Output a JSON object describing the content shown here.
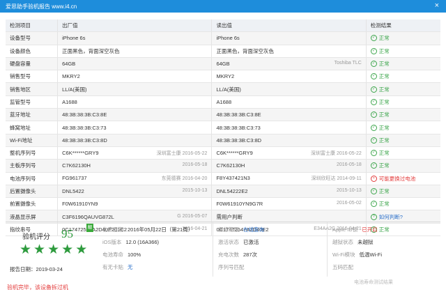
{
  "window": {
    "title": "爱思助手验机报告 www.i4.cn",
    "close_label": "×"
  },
  "table": {
    "headers": [
      "检测项目",
      "出厂值",
      "读出值",
      "检测结果"
    ],
    "rows": [
      {
        "label": "设备型号",
        "factory": "iPhone 6s",
        "factory_note": "",
        "read": "iPhone 6s",
        "read_note": "",
        "result": "正常",
        "status": "ok"
      },
      {
        "label": "设备颜色",
        "factory": "正面黑色，背面深空灰色",
        "factory_note": "",
        "read": "正面黑色，背面深空灰色",
        "read_note": "",
        "result": "正常",
        "status": "ok"
      },
      {
        "label": "硬盘容量",
        "factory": "64GB",
        "factory_note": "",
        "read": "64GB",
        "read_note": "Toshiba TLC",
        "result": "正常",
        "status": "ok"
      },
      {
        "label": "销售型号",
        "factory": "MKRY2",
        "factory_note": "",
        "read": "MKRY2",
        "read_note": "",
        "result": "正常",
        "status": "ok"
      },
      {
        "label": "销售地区",
        "factory": "LL/A(美国)",
        "factory_note": "",
        "read": "LL/A(美国)",
        "read_note": "",
        "result": "正常",
        "status": "ok"
      },
      {
        "label": "监管型号",
        "factory": "A1688",
        "factory_note": "",
        "read": "A1688",
        "read_note": "",
        "result": "正常",
        "status": "ok"
      },
      {
        "label": "蓝牙地址",
        "factory": "48:3B:38:3B:C3:8E",
        "factory_note": "",
        "read": "48:3B:38:3B:C3:8E",
        "read_note": "",
        "result": "正常",
        "status": "ok"
      },
      {
        "label": "蜂窝地址",
        "factory": "48:3B:38:3B:C3:73",
        "factory_note": "",
        "read": "48:3B:38:3B:C3:73",
        "read_note": "",
        "result": "正常",
        "status": "ok"
      },
      {
        "label": "Wi-Fi地址",
        "factory": "48:3B:38:3B:C3:8D",
        "factory_note": "",
        "read": "48:3B:38:3B:C3:8D",
        "read_note": "",
        "result": "正常",
        "status": "ok"
      },
      {
        "label": "整机序列号",
        "factory": "C6K******GRY9",
        "factory_note": "深圳富士康 2016-05-22",
        "read": "C6K******GRY9",
        "read_note": "深圳富士康 2016-05-22",
        "result": "正常",
        "status": "ok"
      },
      {
        "label": "主板序列号",
        "factory": "C7K62130H",
        "factory_note": "2016-05-18",
        "read": "C7K62130H",
        "read_note": "2016-05-18",
        "result": "正常",
        "status": "ok"
      },
      {
        "label": "电池序列号",
        "factory": "FG961737",
        "factory_note": "东莞德赛 2016-04-20",
        "read": "F8Y437421N3",
        "read_note": "深圳欣旺达 2014-09-11",
        "result": "可能更换过电池",
        "status": "bad"
      },
      {
        "label": "后置摄像头",
        "factory": "DNL5422",
        "factory_note": "2015-10-13",
        "read": "DNL54222E2",
        "read_note": "2015-10-13",
        "result": "正常",
        "status": "ok"
      },
      {
        "label": "前置摄像头",
        "factory": "F0W61910YN9",
        "factory_note": "",
        "read": "F0W61910YN9G7R",
        "read_note": "2016-05-02",
        "result": "正常",
        "status": "ok"
      },
      {
        "label": "液晶显示屏",
        "factory": "C3F6196QAUVG872L",
        "factory_note": "G 2016-05-07",
        "read": "需用户判断",
        "read_note": "",
        "result": "如何判断?",
        "status": "ask"
      },
      {
        "label": "指纹串号",
        "factory": "0C17472547A2D40E201C2",
        "factory_note": "2016-04-21",
        "read": "0C17472547A2D40E2",
        "read_note": "E34AA2C 2016-04-21",
        "result": "正常",
        "status": "ok"
      }
    ]
  },
  "summary": {
    "score_label": "验机评分",
    "score": "95",
    "badge": "靓",
    "stars": 5,
    "star_char": "★",
    "report_date": "报告日期：2019-03-24",
    "info": [
      {
        "key": "生产日期",
        "value": "2016年05月22日（第21周）",
        "tone": "normal"
      },
      {
        "key": "保修期限",
        "value": "在线查询",
        "tone": "blue"
      },
      {
        "key": "Apple ID锁",
        "value": "已开启",
        "tone": "red"
      },
      {
        "key": "iOS版本",
        "value": "12.0 (16A366)",
        "tone": "normal"
      },
      {
        "key": "激活状态",
        "value": "已激活",
        "tone": "normal"
      },
      {
        "key": "越狱状态",
        "value": "未越狱",
        "tone": "normal"
      },
      {
        "key": "电池寿命",
        "value": "100%",
        "tone": "normal"
      },
      {
        "key": "充电次数",
        "value": "287次",
        "tone": "normal"
      },
      {
        "key": "Wi-Fi模块",
        "value": "低温Wi-Fi",
        "tone": "normal"
      },
      {
        "key": "有无卡贴",
        "value": "无",
        "tone": "blue"
      },
      {
        "key": "序列号匹配",
        "value": "",
        "tone": "normal"
      },
      {
        "key": "五码匹配",
        "value": "",
        "tone": "normal"
      }
    ]
  },
  "footer": {
    "message": "验机完毕，该设备拆过机",
    "right_hint": "电池寿命测试结果"
  },
  "colors": {
    "title_bar": "#1e8ddb",
    "ok": "#3ba54a",
    "bad": "#e33a3a",
    "link": "#2a6fc9",
    "star": "#2e9b3e"
  }
}
